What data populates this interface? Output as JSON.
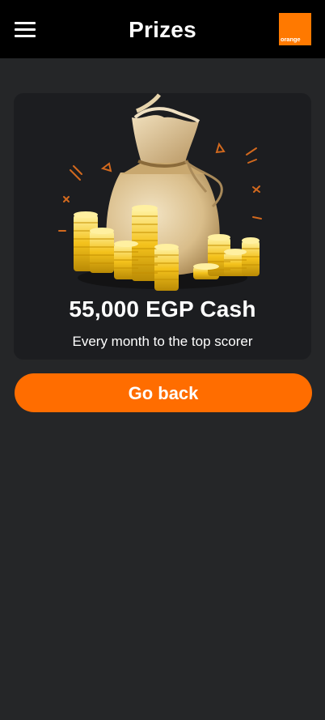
{
  "header": {
    "title": "Prizes",
    "menu_icon": "hamburger-menu-icon",
    "brand": {
      "text": "orange",
      "color": "#ff7900"
    }
  },
  "prize": {
    "image_icon": "money-bag-with-gold-coins",
    "amount": "55,000 EGP Cash",
    "description": "Every month to the top scorer"
  },
  "actions": {
    "go_back_label": "Go back",
    "accent": "#ff6d00"
  },
  "colors": {
    "page_background": "#252628",
    "header_background": "#000000",
    "card_background": "#1c1d20"
  }
}
